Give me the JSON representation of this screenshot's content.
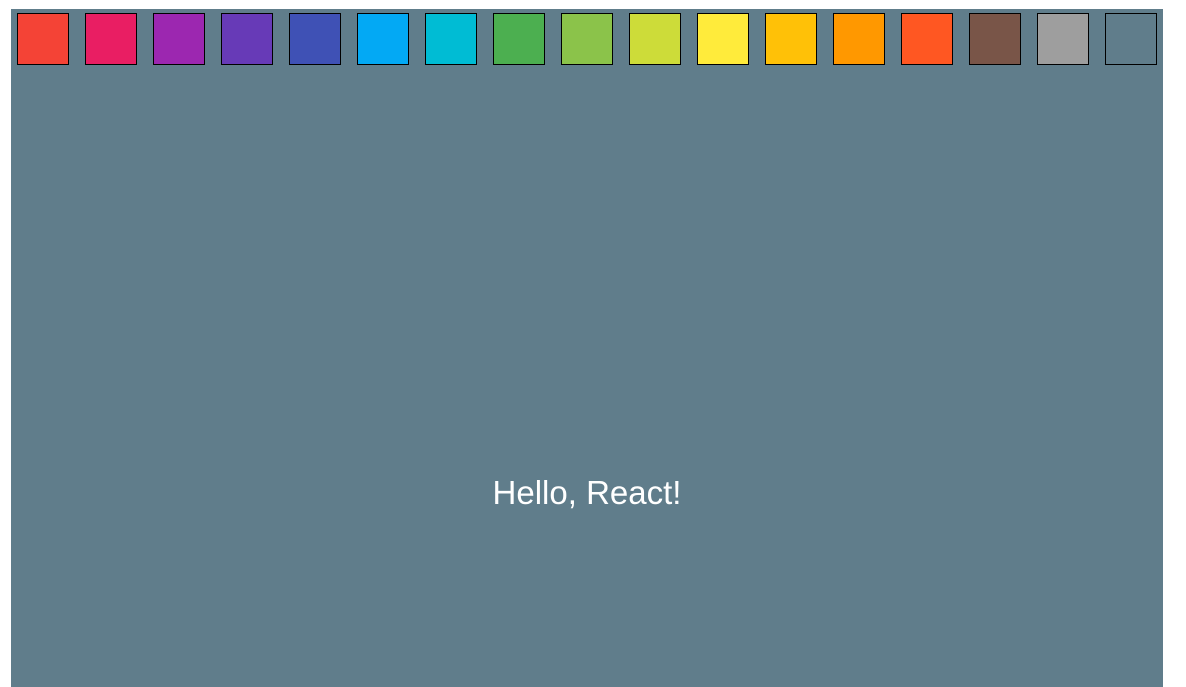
{
  "app": {
    "background_color": "#607d8b",
    "greeting": "Hello, React!"
  },
  "color_picker": {
    "swatches": [
      {
        "name": "red",
        "color": "#f44336"
      },
      {
        "name": "pink",
        "color": "#e91e63"
      },
      {
        "name": "purple",
        "color": "#9c27b0"
      },
      {
        "name": "deep-purple",
        "color": "#673ab7"
      },
      {
        "name": "indigo",
        "color": "#3f51b5"
      },
      {
        "name": "light-blue",
        "color": "#03a9f4"
      },
      {
        "name": "cyan",
        "color": "#00bcd4"
      },
      {
        "name": "green",
        "color": "#4caf50"
      },
      {
        "name": "light-green",
        "color": "#8bc34a"
      },
      {
        "name": "lime",
        "color": "#cddc39"
      },
      {
        "name": "yellow",
        "color": "#ffeb3b"
      },
      {
        "name": "amber",
        "color": "#ffc107"
      },
      {
        "name": "orange",
        "color": "#ff9800"
      },
      {
        "name": "deep-orange",
        "color": "#ff5722"
      },
      {
        "name": "brown",
        "color": "#795548"
      },
      {
        "name": "grey",
        "color": "#9e9e9e"
      },
      {
        "name": "blue-grey",
        "color": "#607d8b"
      }
    ]
  }
}
